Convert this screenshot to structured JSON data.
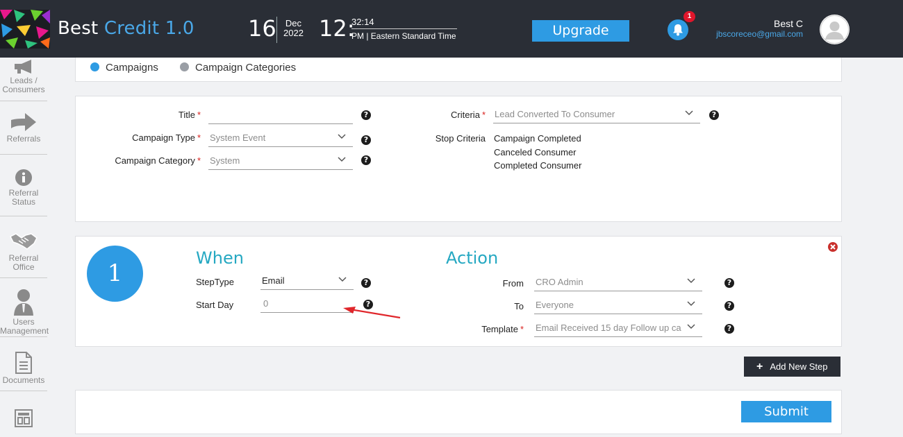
{
  "app": {
    "brand_main": "Best ",
    "brand_accent": "Credit 1.0"
  },
  "header": {
    "day": "16",
    "month": "Dec",
    "year": "2022",
    "hour": "12:",
    "minute_second": "32:14",
    "timezone": "PM | Eastern Standard Time",
    "upgrade_label": "Upgrade",
    "notification_count": "1",
    "user_name": "Best C",
    "user_email": "jbscoreceo@gmail.com"
  },
  "sidebar": {
    "items": [
      {
        "label1": "Leads /",
        "label2": "Consumers",
        "icon": "megaphone-icon"
      },
      {
        "label1": "Referrals",
        "label2": "",
        "icon": "arrow-right-icon"
      },
      {
        "label1": "Referral",
        "label2": "Status",
        "icon": "info-icon"
      },
      {
        "label1": "Referral",
        "label2": "Office",
        "icon": "handshake-icon"
      },
      {
        "label1": "Users",
        "label2": "Management",
        "icon": "user-icon"
      },
      {
        "label1": "Documents",
        "label2": "",
        "icon": "document-icon"
      },
      {
        "label1": "",
        "label2": "",
        "icon": "layout-icon"
      }
    ]
  },
  "tabs": [
    {
      "label": "Campaigns",
      "color": "#2e9be3"
    },
    {
      "label": "Campaign Categories",
      "color": "#9a9ea5"
    }
  ],
  "form": {
    "title_label": "Title",
    "title_value": "",
    "campaign_type_label": "Campaign Type",
    "campaign_type_value": "System Event",
    "campaign_category_label": "Campaign Category",
    "campaign_category_value": "System",
    "criteria_label": "Criteria",
    "criteria_value": "Lead Converted To Consumer",
    "stop_criteria_label": "Stop Criteria",
    "stop_criteria": [
      "Campaign Completed",
      "Canceled Consumer",
      "Completed Consumer"
    ],
    "required_mark": "*",
    "help_glyph": "?"
  },
  "step": {
    "number": "1",
    "when_heading": "When",
    "action_heading": "Action",
    "step_type_label": "StepType",
    "step_type_value": "Email",
    "start_day_label": "Start Day",
    "start_day_placeholder": "0",
    "from_label": "From",
    "from_value": "CRO Admin",
    "to_label": "To",
    "to_value": "Everyone",
    "template_label": "Template",
    "template_value": "Email Received 15 day Follow up ca"
  },
  "buttons": {
    "add_step_label": "Add New Step",
    "add_step_plus": "+",
    "submit_label": "Submit"
  },
  "colors": {
    "accent": "#2e9be3",
    "header_bg": "#2a2e36",
    "section_heading": "#25a8c2",
    "required": "#d9211e",
    "annotation_arrow": "#e0262b"
  }
}
